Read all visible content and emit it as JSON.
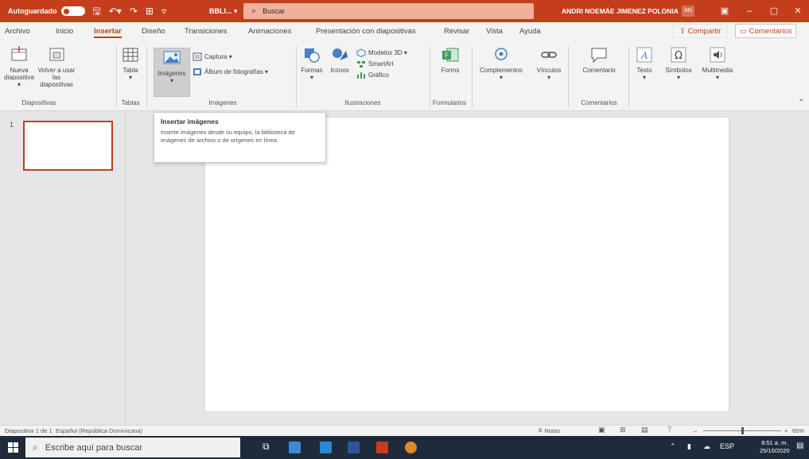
{
  "titlebar": {
    "autosave_label": "Autoguardado",
    "file_name": "BBLI... ▾",
    "search_placeholder": "Buscar",
    "user_name": "ANDRI NOEMÁE JIMENEZ POLONIA",
    "user_initials": "AN"
  },
  "menu": {
    "tabs": [
      "Archivo",
      "Inicio",
      "Insertar",
      "Diseño",
      "Transiciones",
      "Animaciones",
      "Presentación con diapositivas",
      "Revisar",
      "Vista",
      "Ayuda"
    ],
    "active_tab": "Insertar",
    "share_label": "Compartir",
    "comments_label": "Comentarios"
  },
  "ribbon": {
    "new_slide": "Nueva diapositiva ▾",
    "reuse_slides": "Volver a usar las diapositivas",
    "table": "Tabla",
    "images": "Imágenes",
    "capture": "Captura ▾",
    "album": "Álbum de fotografías ▾",
    "shapes": "Formas",
    "icons": "Iconos",
    "models3d": "Modelos 3D ▾",
    "smartart": "SmartArt",
    "chart": "Gráfico",
    "forms": "Forms",
    "addins": "Complementos",
    "links": "Vínculos",
    "comment": "Comentario",
    "text": "Texto",
    "symbols": "Símbolos",
    "multimedia": "Multimedia",
    "groups": {
      "slides": "Diapositivas",
      "tables": "Tablas",
      "images": "Imágenes",
      "illustrations": "Ilustraciones",
      "forms": "Formularios",
      "comments": "Comentarios"
    }
  },
  "tooltip": {
    "title": "Insertar imágenes",
    "body": "Inserte imágenes desde su equipo, la biblioteca de imágenes de archivo o de orígenes en línea."
  },
  "slides": {
    "thumb_number": "1"
  },
  "status": {
    "slide_count": "Diapositiva 1 de 1",
    "language": "Español (República Dominicana)",
    "notes": "Notas",
    "zoom": "65%"
  },
  "taskbar": {
    "search_placeholder": "Escribe aquí para buscar",
    "language": "ESP",
    "time": "8:51 a. m.",
    "date": "25/10/2020"
  },
  "colors": {
    "accent": "#c43e1c",
    "search_bg": "#f2b09c",
    "taskbar": "#1f2b3a"
  }
}
